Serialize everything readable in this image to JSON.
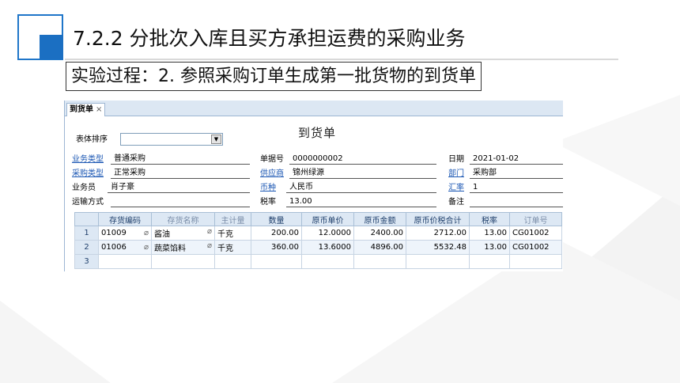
{
  "slide": {
    "title": "7.2.2  分批次入库且买方承担运费的采购业务",
    "subtitle": "实验过程：2. 参照采购订单生成第一批货物的到货单"
  },
  "window": {
    "tab_label": "到货单",
    "tab_close": "×",
    "form_title": "到货单",
    "sort_label": "表体排序",
    "sort_value": "",
    "header_fields": {
      "business_type": {
        "label": "业务类型",
        "value": "普通采购"
      },
      "purchase_type": {
        "label": "采购类型",
        "value": "正常采购"
      },
      "salesman": {
        "label": "业务员",
        "value": "肖子豪"
      },
      "transport": {
        "label": "运输方式",
        "value": ""
      },
      "doc_no": {
        "label": "单据号",
        "value": "0000000002"
      },
      "supplier": {
        "label": "供应商",
        "value": "锦州绿源"
      },
      "currency": {
        "label": "币种",
        "value": "人民币"
      },
      "tax_rate": {
        "label": "税率",
        "value": "13.00"
      },
      "date": {
        "label": "日期",
        "value": "2021-01-02"
      },
      "department": {
        "label": "部门",
        "value": "采购部"
      },
      "exchange_rate": {
        "label": "汇率",
        "value": "1"
      },
      "remark": {
        "label": "备注",
        "value": ""
      }
    },
    "grid": {
      "columns": [
        "存货编码",
        "存货名称",
        "主计量",
        "数量",
        "原币单价",
        "原币金额",
        "原币价税合计",
        "税率",
        "订单号"
      ],
      "rows": [
        {
          "idx": "1",
          "code": "01009",
          "name": "酱油",
          "unit": "千克",
          "qty": "200.00",
          "price": "12.0000",
          "amount": "2400.00",
          "total": "2712.00",
          "tax": "13.00",
          "order": "CG01002"
        },
        {
          "idx": "2",
          "code": "01006",
          "name": "蔬菜馅料",
          "unit": "千克",
          "qty": "360.00",
          "price": "13.6000",
          "amount": "4896.00",
          "total": "5532.48",
          "tax": "13.00",
          "order": "CG01002"
        },
        {
          "idx": "3",
          "code": "",
          "name": "",
          "unit": "",
          "qty": "",
          "price": "",
          "amount": "",
          "total": "",
          "tax": "",
          "order": ""
        }
      ]
    }
  },
  "icons": {
    "dropdown": "triangle-down-icon",
    "attachment": "paperclip-icon"
  },
  "colors": {
    "accent": "#1b6fc2",
    "link": "#1a56b3",
    "grid_header": "#dde8f4"
  }
}
